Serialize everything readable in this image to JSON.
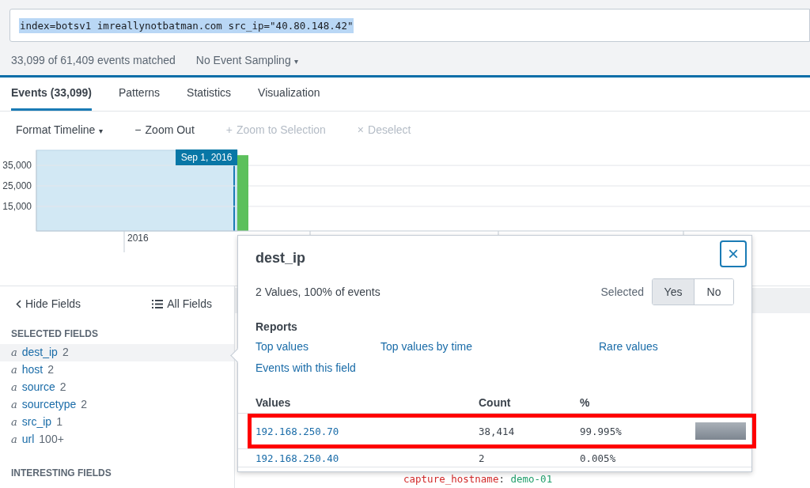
{
  "search": {
    "value": "index=botsv1 imreallynotbatman.com src_ip=\"40.80.148.42\""
  },
  "summary": {
    "matched": "33,099 of 61,409 events matched",
    "sampling": "No Event Sampling",
    "caret": "▾"
  },
  "tabs": [
    {
      "label": "Events (33,099)",
      "selected": true
    },
    {
      "label": "Patterns",
      "selected": false
    },
    {
      "label": "Statistics",
      "selected": false
    },
    {
      "label": "Visualization",
      "selected": false
    }
  ],
  "toolbar": [
    {
      "label": "Format Timeline",
      "caret": "▾",
      "disabled": false
    },
    {
      "icon": "−",
      "label": "Zoom Out",
      "disabled": false
    },
    {
      "icon": "+",
      "label": "Zoom to Selection",
      "disabled": true
    },
    {
      "icon": "×",
      "label": "Deselect",
      "disabled": true
    }
  ],
  "timeline": {
    "tooltip": "Sep 1, 2016",
    "chart_data": {
      "type": "bar",
      "categories": [
        "2016"
      ],
      "values": [
        40000
      ],
      "ylim": [
        3000,
        42000
      ],
      "grid": true,
      "yticks": [
        {
          "value": 35000,
          "label": "35,000"
        },
        {
          "value": 25000,
          "label": "25,000"
        },
        {
          "value": 15000,
          "label": "15,000"
        }
      ]
    }
  },
  "sidebar": {
    "hide": "Hide Fields",
    "all": "All Fields",
    "selected_heading": "SELECTED FIELDS",
    "fields": [
      {
        "type": "a",
        "name": "dest_ip",
        "count": "2",
        "selected": true
      },
      {
        "type": "a",
        "name": "host",
        "count": "2",
        "selected": false
      },
      {
        "type": "a",
        "name": "source",
        "count": "2",
        "selected": false
      },
      {
        "type": "a",
        "name": "sourcetype",
        "count": "2",
        "selected": false
      },
      {
        "type": "a",
        "name": "src_ip",
        "count": "1",
        "selected": false
      },
      {
        "type": "a",
        "name": "url",
        "count": "100+",
        "selected": false
      }
    ],
    "interesting_heading": "INTERESTING FIELDS"
  },
  "event_line": {
    "key": "capture_hostname",
    "sep": ":",
    "value": "demo-01"
  },
  "popup": {
    "title": "dest_ip",
    "close": "×",
    "stats": "2 Values, 100% of events",
    "selected_label": "Selected",
    "toggle": [
      {
        "label": "Yes",
        "selected": true
      },
      {
        "label": "No",
        "selected": false
      }
    ],
    "reports_heading": "Reports",
    "reports": [
      "Top values",
      "Top values by time",
      "Rare values",
      "Events with this field"
    ],
    "columns": [
      "Values",
      "Count",
      "%"
    ],
    "rows": [
      {
        "value": "192.168.250.70",
        "count": "38,414",
        "percent": "99.995%",
        "level": 0.99995,
        "highlighted": true
      },
      {
        "value": "192.168.250.40",
        "count": "2",
        "percent": "0.005%",
        "highlighted": false
      }
    ]
  }
}
